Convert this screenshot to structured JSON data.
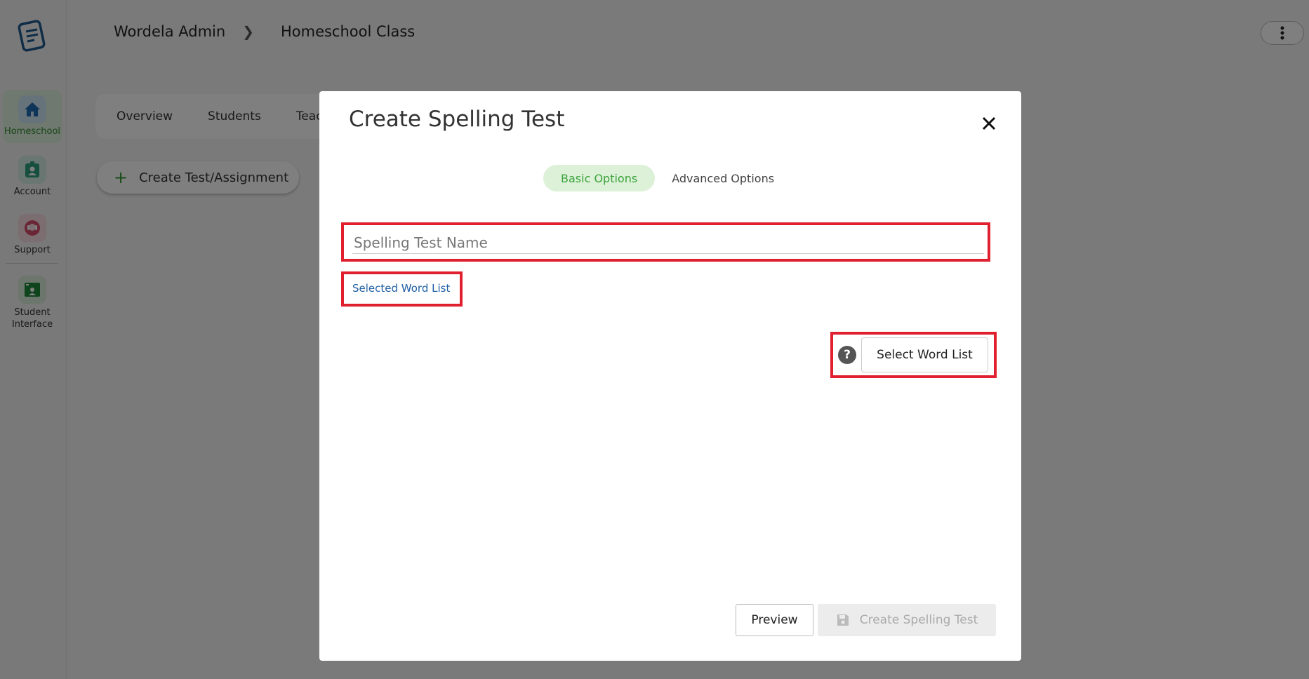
{
  "breadcrumb": {
    "items": [
      "Wordela Admin",
      "Homeschool Class"
    ]
  },
  "sidebar": {
    "items": [
      {
        "label": "Homeschool",
        "icon": "home-icon"
      },
      {
        "label": "Account",
        "icon": "account-badge-icon"
      },
      {
        "label": "Support",
        "icon": "support-icon"
      },
      {
        "label": "Student Interface",
        "icon": "student-interface-icon"
      }
    ]
  },
  "page": {
    "tabs": [
      "Overview",
      "Students",
      "Teac"
    ],
    "create_button": "Create Test/Assignment"
  },
  "modal": {
    "title": "Create Spelling Test",
    "tabs": {
      "basic": "Basic Options",
      "advanced": "Advanced Options"
    },
    "name_placeholder": "Spelling Test Name",
    "selected_word_list": "Selected Word List",
    "help_symbol": "?",
    "select_word_list_button": "Select Word List",
    "preview_button": "Preview",
    "create_button": "Create Spelling Test"
  },
  "colors": {
    "accent_green": "#3ca33c",
    "highlight_red": "#e0202e",
    "link_blue": "#1f5fa5"
  }
}
